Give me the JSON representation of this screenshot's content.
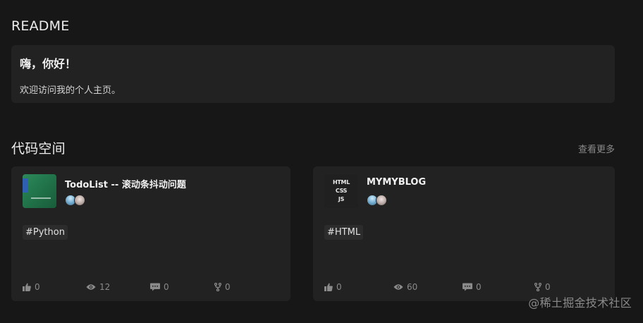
{
  "readme": {
    "section_title": "README",
    "heading": "嗨，你好！",
    "body": "欢迎访问我的个人主页。"
  },
  "codespace": {
    "section_title": "代码空间",
    "view_more": "查看更多",
    "repos": [
      {
        "name": "TodoList -- 滚动条抖动问题",
        "thumbnail": "green-cover-image",
        "tag": "#Python",
        "likes": "0",
        "views": "12",
        "comments": "0",
        "forks": "0"
      },
      {
        "name": "MYMYBLOG",
        "thumbnail_text": [
          "HTML",
          "CSS",
          "JS"
        ],
        "tag": "#HTML",
        "likes": "0",
        "views": "60",
        "comments": "0",
        "forks": "0"
      }
    ]
  },
  "watermark": "@稀土掘金技术社区",
  "colors": {
    "background": "#171717",
    "card": "#222222",
    "muted": "#8a8a8a"
  },
  "icons": [
    "thumbs-up-icon",
    "eye-icon",
    "comment-icon",
    "fork-icon"
  ]
}
